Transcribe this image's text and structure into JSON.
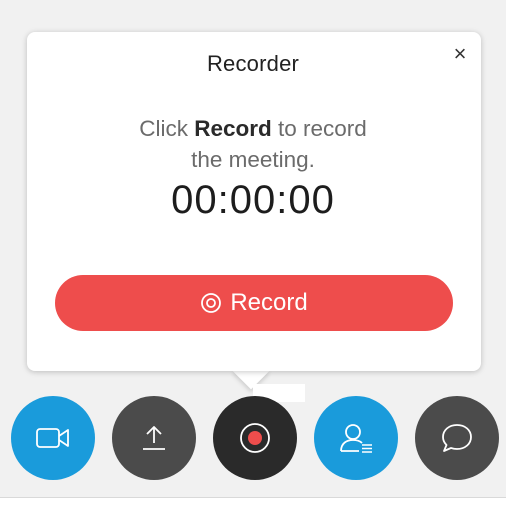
{
  "popup": {
    "title": "Recorder",
    "close_icon": "×",
    "message_prefix": "Click ",
    "message_bold": "Record",
    "message_line1_suffix": " to record",
    "message_line2": "the meeting.",
    "timer": "00:00:00",
    "record_button_label": "Record"
  },
  "toolbar": {
    "buttons": [
      {
        "name": "video-button",
        "icon": "video-camera-icon",
        "color": "#1a9bdb"
      },
      {
        "name": "share-button",
        "icon": "upload-icon",
        "color": "#4b4b4b"
      },
      {
        "name": "recorder-button",
        "icon": "record-icon",
        "color": "#2a2a2a"
      },
      {
        "name": "participants-button",
        "icon": "participants-icon",
        "color": "#1a9bdb"
      },
      {
        "name": "chat-button",
        "icon": "chat-icon",
        "color": "#4b4b4b"
      }
    ]
  },
  "colors": {
    "record_red": "#ee4d4c",
    "accent_blue": "#1a9bdb",
    "dark_gray": "#4b4b4b"
  }
}
